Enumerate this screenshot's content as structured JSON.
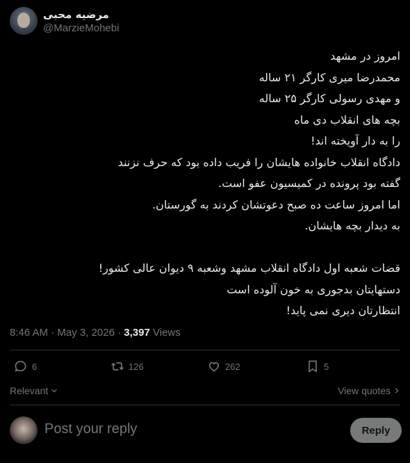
{
  "author": {
    "display_name": "مرضیه محبی",
    "handle": "@MarzieMohebi"
  },
  "tweet": {
    "lines": [
      "امروز در مشهد",
      "محمدرضا میری کارگر ۲۱ ساله",
      "و مهدی رسولی کارگر ۲۵ ساله",
      "بچه های انقلاب دی ماه",
      "را به دار آویخته اند!",
      "دادگاه انقلاب خانواده هایشان را فریب داده بود که حرف نزنند",
      "گفته بود پرونده در کمیسیون عفو است.",
      "اما امروز ساعت ده صبح دعوتشان کردند به گورستان.",
      "به دیدار بچه هایشان.",
      "",
      "قضات شعبه اول دادگاه انقلاب مشهد وشعبه ۹ دیوان عالی کشور!",
      "دستهایتان بدجوری به خون آلوده است",
      "انتظارتان دیری نمی پاید!"
    ],
    "time": "8:46 AM",
    "date": "May 3, 2026",
    "views_count": "3,397",
    "views_label": "Views"
  },
  "actions": {
    "replies": "6",
    "reposts": "126",
    "likes": "262",
    "bookmarks": "5"
  },
  "sort": {
    "relevant_label": "Relevant",
    "view_quotes_label": "View quotes"
  },
  "reply": {
    "placeholder": "Post your reply",
    "button_label": "Reply"
  }
}
